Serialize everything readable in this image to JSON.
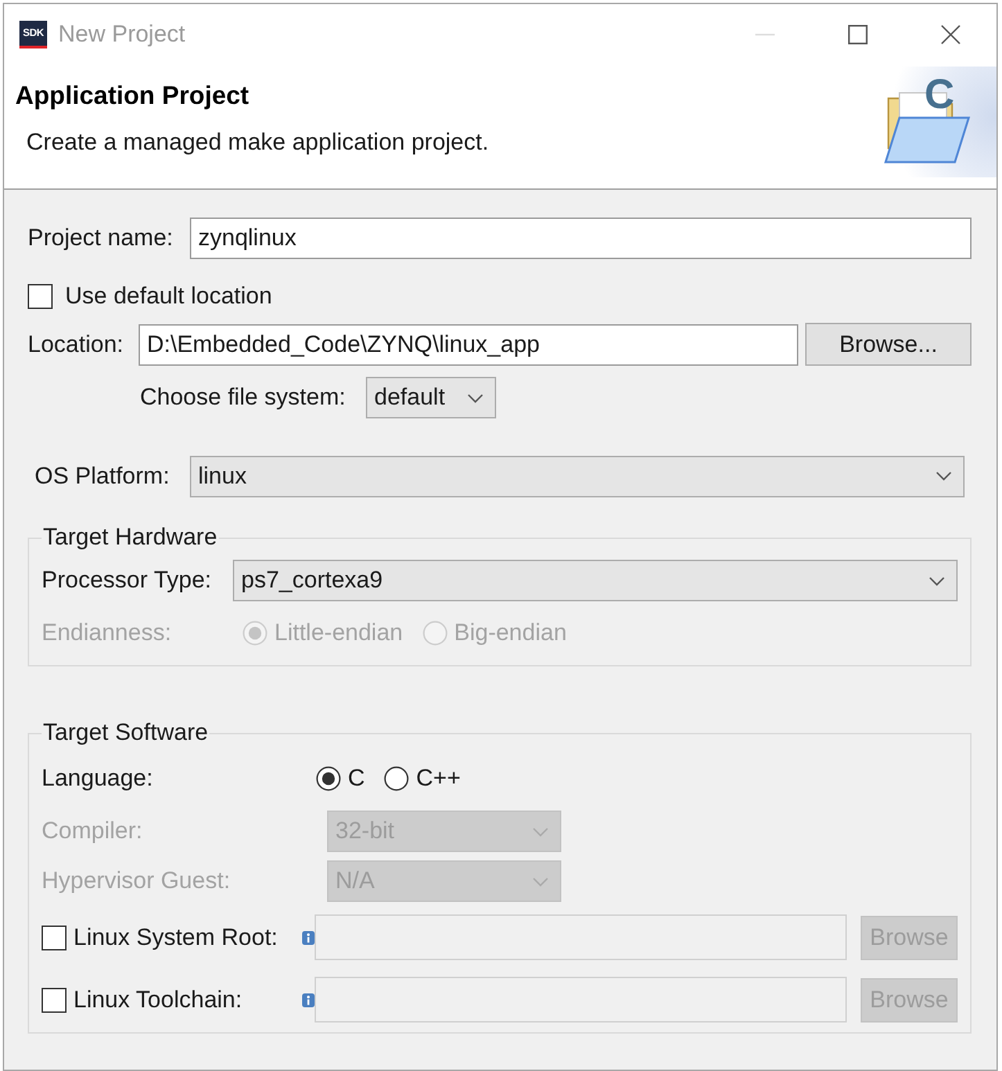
{
  "window": {
    "title": "New Project",
    "logo_text": "SDK",
    "controls": [
      {
        "kind": "minimize",
        "disabled": true
      },
      {
        "kind": "maximize",
        "disabled": false
      },
      {
        "kind": "close",
        "disabled": false
      }
    ]
  },
  "header": {
    "title": "Application Project",
    "description": "Create a managed make application project.",
    "icon_letter": "C"
  },
  "project_name": {
    "label": "Project name:",
    "value": "zynqlinux"
  },
  "use_default_location": {
    "label": "Use default location",
    "checked": false
  },
  "location": {
    "label": "Location:",
    "value": "D:\\Embedded_Code\\ZYNQ\\linux_app",
    "button": "Browse..."
  },
  "file_system": {
    "label": "Choose file system:",
    "value": "default"
  },
  "os_platform": {
    "label": "OS Platform:",
    "value": "linux"
  },
  "target_hardware": {
    "title": "Target Hardware",
    "processor_type": {
      "label": "Processor Type:",
      "value": "ps7_cortexa9"
    },
    "endianness": {
      "label": "Endianness:",
      "disabled": true,
      "options": [
        {
          "label": "Little-endian",
          "selected": true
        },
        {
          "label": "Big-endian",
          "selected": false
        }
      ]
    }
  },
  "target_software": {
    "title": "Target Software",
    "language": {
      "label": "Language:",
      "disabled": false,
      "options": [
        {
          "label": "C",
          "selected": true
        },
        {
          "label": "C++",
          "selected": false
        }
      ]
    },
    "compiler": {
      "label": "Compiler:",
      "value": "32-bit",
      "disabled": true
    },
    "hypervisor_guest": {
      "label": "Hypervisor Guest:",
      "value": "N/A",
      "disabled": true
    },
    "paths": [
      {
        "label": "Linux System Root:",
        "checked": false,
        "disabled": true,
        "button": "Browse"
      },
      {
        "label": "Linux Toolchain:",
        "checked": false,
        "disabled": true,
        "button": "Browse"
      }
    ]
  }
}
